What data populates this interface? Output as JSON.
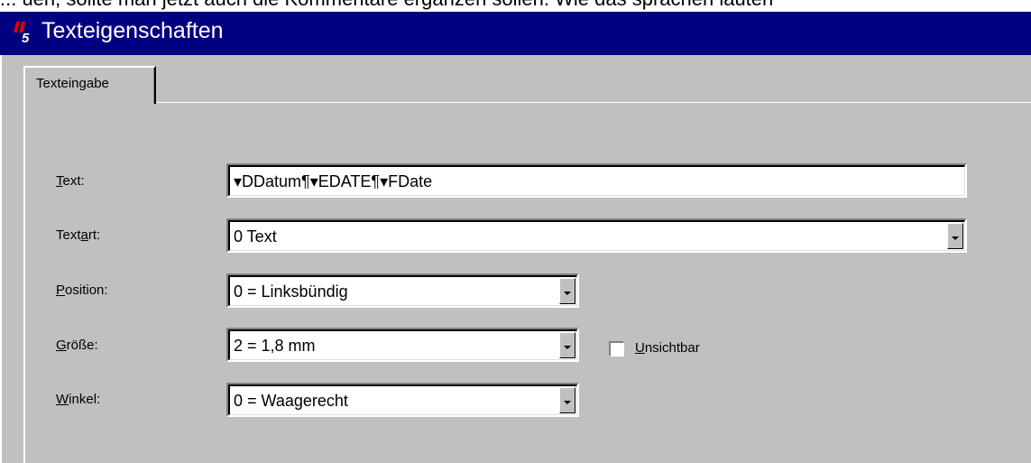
{
  "background_fragment": "... uen, sollte man jetzt auch die Kommentare ergänzen sollen. Wie das sprachen lauten",
  "window": {
    "title": "Texteigenschaften"
  },
  "tabs": [
    {
      "label": "Texteingabe"
    }
  ],
  "form": {
    "text": {
      "label_pre": "",
      "label_mnemonic": "T",
      "label_post": "ext:",
      "value": "▾DDatum¶▾EDATE¶▾FDate"
    },
    "textart": {
      "label_pre": "Text",
      "label_mnemonic": "a",
      "label_post": "rt:",
      "value": "0 Text"
    },
    "position": {
      "label_pre": "",
      "label_mnemonic": "P",
      "label_post": "osition:",
      "value": "0 = Linksbündig"
    },
    "groesse": {
      "label_pre": "",
      "label_mnemonic": "G",
      "label_post": "röße:",
      "value": "2 = 1,8 mm"
    },
    "winkel": {
      "label_pre": "",
      "label_mnemonic": "W",
      "label_post": "inkel:",
      "value": "0 = Waagerecht"
    },
    "unsichtbar": {
      "label_mnemonic": "U",
      "label_post": "nsichtbar",
      "checked": false
    }
  },
  "colors": {
    "titlebar": "#000080",
    "dialog_bg": "#c0c0c0",
    "field_bg": "#ffffff"
  },
  "icons": {
    "title": "app-logo-icon",
    "dropdown": "dropdown-arrow-icon"
  }
}
